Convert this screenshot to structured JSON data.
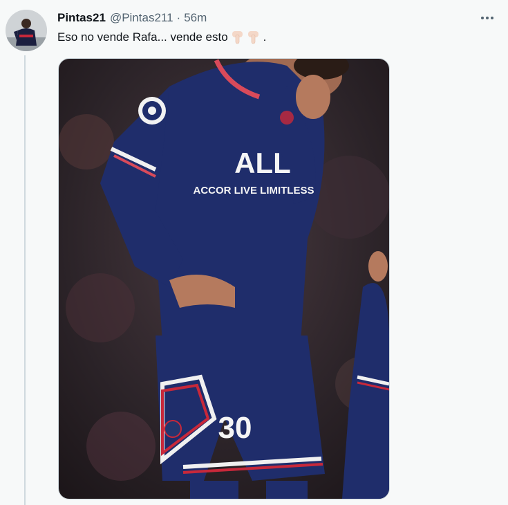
{
  "tweet": {
    "display_name": "Pintas21",
    "handle": "@Pintas211",
    "separator": "·",
    "time": "56m",
    "text": "Eso no vende Rafa... vende esto",
    "text_end": ".",
    "emojis": [
      "pointing-down-hand-emoji",
      "pointing-down-hand-emoji"
    ],
    "more_icon": "more-options-icon"
  },
  "media": {
    "sponsor_text": "ALL",
    "sponsor_subtext": "ACCOR LIVE LIMITLESS",
    "shorts_number": "30"
  },
  "colors": {
    "background": "#f7f9f9",
    "text_primary": "#0f1419",
    "text_secondary": "#536471",
    "jersey_navy": "#1f2d6b",
    "trim_red": "#c8283a"
  }
}
